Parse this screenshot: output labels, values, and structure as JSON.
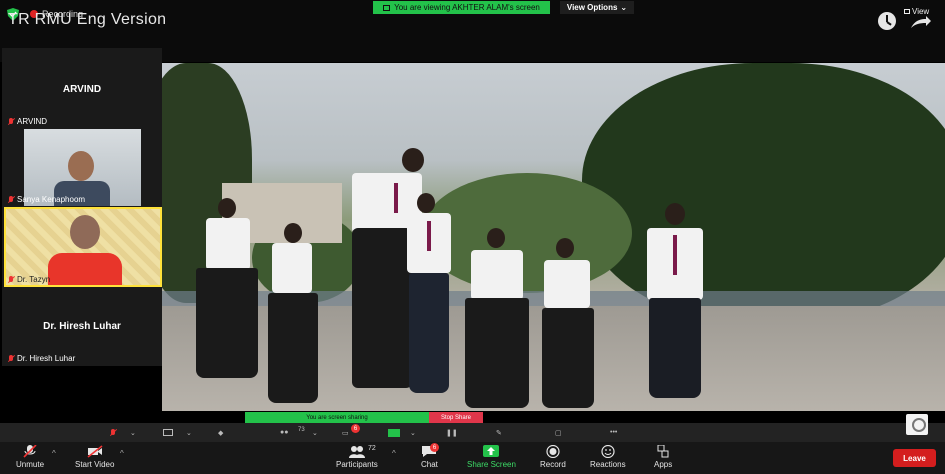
{
  "header": {
    "recording_label": "Recording",
    "meeting_title": "TR RMU Eng Version",
    "share_banner": "You are viewing AKHTER ALAM's screen",
    "view_options": "View Options",
    "view_label": "View"
  },
  "participants": [
    {
      "name": "ARVIND",
      "display": "ARVIND",
      "video": false
    },
    {
      "name": "Sanya Kenaphoom",
      "video": true
    },
    {
      "name": "Dr. Tazyn",
      "video": true
    },
    {
      "name": "Dr. Hiresh Luhar",
      "display": "Dr. Hiresh Luhar",
      "video": false
    }
  ],
  "sharing_bar": {
    "label": "You are screen sharing",
    "stop_label": "Stop Share"
  },
  "thin_toolbar": {
    "participants_count": "73",
    "chat_badge": "6"
  },
  "toolbar": {
    "unmute": "Unmute",
    "start_video": "Start Video",
    "participants": "Participants",
    "participants_count": "72",
    "chat": "Chat",
    "chat_badge": "6",
    "share_screen": "Share Screen",
    "record": "Record",
    "reactions": "Reactions",
    "apps": "Apps",
    "leave": "Leave"
  },
  "colors": {
    "share_green": "#23c24a",
    "leave_red": "#d41e1e",
    "muted_red": "#e33333"
  }
}
